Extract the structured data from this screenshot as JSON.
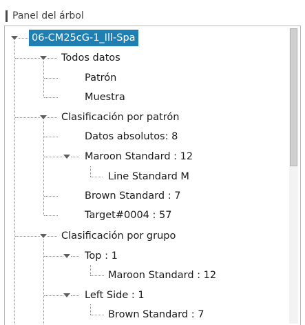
{
  "panel": {
    "title": "Panel del árbol"
  },
  "tree": {
    "root": "06-CM25cG-1_Ill-Spa",
    "todos_datos": {
      "label": "Todos datos",
      "children": [
        "Patrón",
        "Muestra"
      ]
    },
    "clasif_patron": {
      "label": "Clasificación por patrón",
      "children": {
        "abs": "Datos absolutos: 8",
        "maroon": "Maroon Standard : 12",
        "maroon_child": "Line Standard M",
        "brown": "Brown Standard : 7",
        "target": "Target#0004 : 57"
      }
    },
    "clasif_grupo": {
      "label": "Clasificación por grupo",
      "top": {
        "label": "Top : 1",
        "child": "Maroon Standard : 12"
      },
      "left": {
        "label": "Left Side : 1",
        "child": "Brown Standard : 7"
      }
    }
  },
  "colors": {
    "selection": "#1f7fb2",
    "guides": "#8d8d8d"
  },
  "icons": [
    "expander-icon",
    "scrollbar"
  ]
}
